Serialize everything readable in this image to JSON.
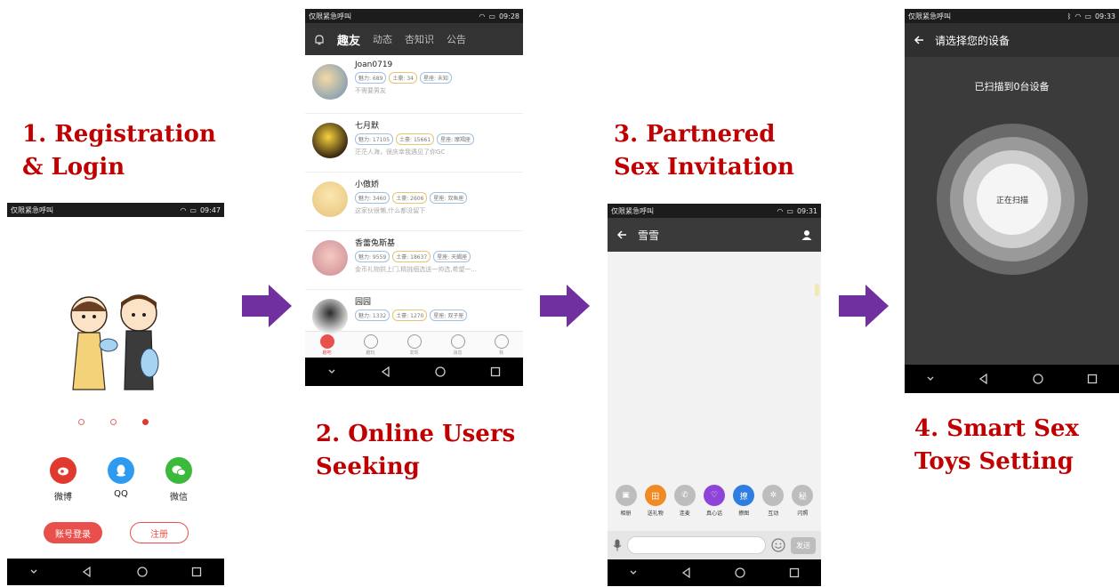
{
  "steps": {
    "step1": {
      "line1": "1. Registration",
      "line2": "& Login"
    },
    "step2": {
      "line1": "2. Online Users",
      "line2": "Seeking"
    },
    "step3": {
      "line1": "3. Partnered",
      "line2": "Sex Invitation"
    },
    "step4": {
      "line1": "4. Smart Sex",
      "line2": "Toys Setting"
    }
  },
  "colors": {
    "step_title": "#c00000",
    "arrow": "#7030a0",
    "accent": "#e9504b"
  },
  "phone1": {
    "status": {
      "carrier": "仅限紧急呼叫",
      "time": "09:47"
    },
    "illustration_icon": "couple-with-violins-illustration",
    "pager": {
      "count": 3,
      "active_index": 2
    },
    "social": [
      {
        "label": "微博",
        "icon": "weibo-icon",
        "color": "#e0392e"
      },
      {
        "label": "QQ",
        "icon": "qq-icon",
        "color": "#2e9bf0"
      },
      {
        "label": "微信",
        "icon": "wechat-icon",
        "color": "#3cb93c"
      }
    ],
    "login_label": "账号登录",
    "register_label": "注册"
  },
  "phone2": {
    "status": {
      "carrier": "仅限紧急呼叫",
      "time": "09:28"
    },
    "tabs": [
      "趣友",
      "动态",
      "杏知识",
      "公告"
    ],
    "users": [
      {
        "name": "Joan0719",
        "charm": "魅力: 689",
        "gold": "土豪: 34",
        "zodiac": "星座: 未知",
        "signature": "不需要男友"
      },
      {
        "name": "七月默",
        "charm": "魅力: 17105",
        "gold": "土豪: 15661",
        "zodiac": "星座: 摩羯座",
        "signature": "茫茫人海，很庆幸我遇见了你GC"
      },
      {
        "name": "小傲娇",
        "charm": "魅力: 3460",
        "gold": "土豪: 2606",
        "zodiac": "星座: 双鱼座",
        "signature": "这家伙很懒,什么都没留下"
      },
      {
        "name": "香蕾兔斯基",
        "charm": "魅力: 9559",
        "gold": "土豪: 18637",
        "zodiac": "星座: 天蝎座",
        "signature": "金币礼物拱上门,精挑细选送一帅选,希望一..."
      },
      {
        "name": "园园",
        "charm": "魅力: 1332",
        "gold": "土豪: 1270",
        "zodiac": "星座: 双子座",
        "signature": ""
      }
    ],
    "bottom_nav": [
      "趣吧",
      "趣玩",
      "发现",
      "消息",
      "我"
    ]
  },
  "phone3": {
    "status": {
      "carrier": "仅限紧急呼叫",
      "time": "09:31"
    },
    "chat_title": "雪雪",
    "actions": [
      {
        "label": "相册",
        "icon": "photo-icon",
        "color": "#bdbdbd"
      },
      {
        "label": "送礼物",
        "icon": "gift-icon",
        "color": "#f08a24"
      },
      {
        "label": "连麦",
        "icon": "phone-icon",
        "color": "#bdbdbd"
      },
      {
        "label": "真心话",
        "icon": "heart-chat-icon",
        "color": "#8e44d8"
      },
      {
        "label": "撩图",
        "icon": "tease-icon",
        "color": "#2e7de0"
      },
      {
        "label": "互动",
        "icon": "interact-icon",
        "color": "#bdbdbd"
      },
      {
        "label": "闪照",
        "icon": "flash-photo-icon",
        "color": "#bdbdbd"
      }
    ],
    "send_label": "发送"
  },
  "phone4": {
    "status": {
      "carrier": "仅限紧急呼叫",
      "time": "09:33"
    },
    "title": "请选择您的设备",
    "scan_result": "已扫描到0台设备",
    "scan_button": "正在扫描"
  }
}
